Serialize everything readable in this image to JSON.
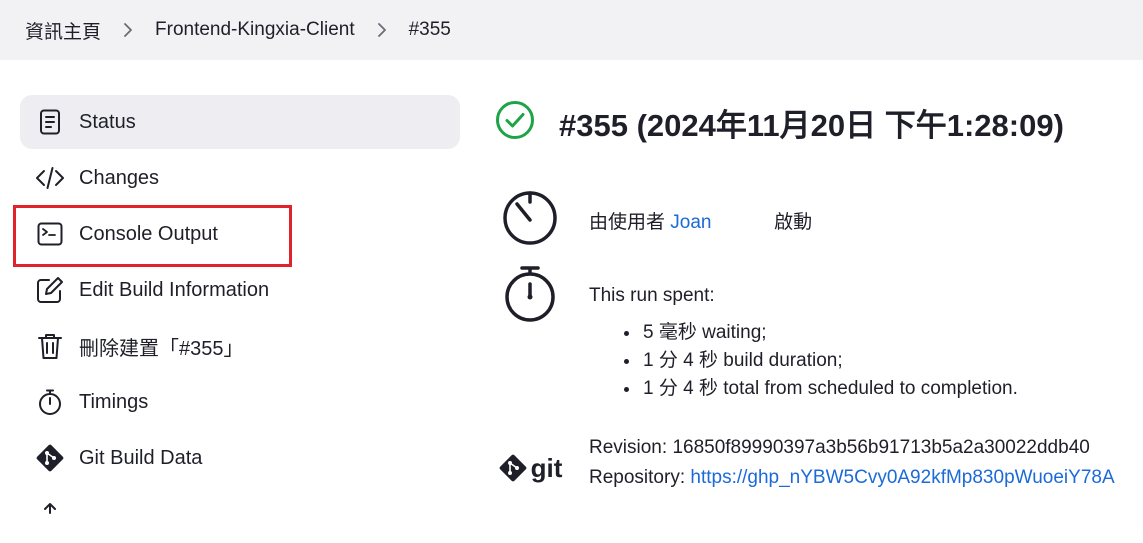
{
  "breadcrumb": {
    "items": [
      "資訊主頁",
      "Frontend-Kingxia-Client",
      "#355"
    ]
  },
  "sidebar": {
    "items": [
      {
        "label": "Status",
        "icon": "document-icon"
      },
      {
        "label": "Changes",
        "icon": "code-icon"
      },
      {
        "label": "Console Output",
        "icon": "terminal-icon"
      },
      {
        "label": "Edit Build Information",
        "icon": "edit-icon"
      },
      {
        "label": "刪除建置「#355」",
        "icon": "trash-icon"
      },
      {
        "label": "Timings",
        "icon": "stopwatch-icon"
      },
      {
        "label": "Git Build Data",
        "icon": "git-icon"
      },
      {
        "label": "",
        "icon": "partial-icon"
      }
    ]
  },
  "build": {
    "title": "#355 (2024年11月20日 下午1:28:09)",
    "status_color": "#1ea446",
    "started_prefix": "由使用者",
    "started_user": "Joan",
    "started_suffix": "啟動",
    "spent_intro": "This run spent:",
    "spent_items": [
      "5 毫秒 waiting;",
      "1 分 4 秒 build duration;",
      "1 分 4 秒 total from scheduled to completion."
    ],
    "git_logo": "git",
    "revision_label": "Revision",
    "revision_value": "16850f89990397a3b56b91713b5a2a30022ddb40",
    "repository_label": "Repository",
    "repository_value": "https://ghp_nYBW5Cvy0A92kfMp830pWuoeiY78A"
  },
  "colors": {
    "highlight": "#e0222b",
    "link": "#1b6ad8",
    "breadcrumb_bg": "#f2f2f5",
    "active_bg": "#eeeef2"
  }
}
